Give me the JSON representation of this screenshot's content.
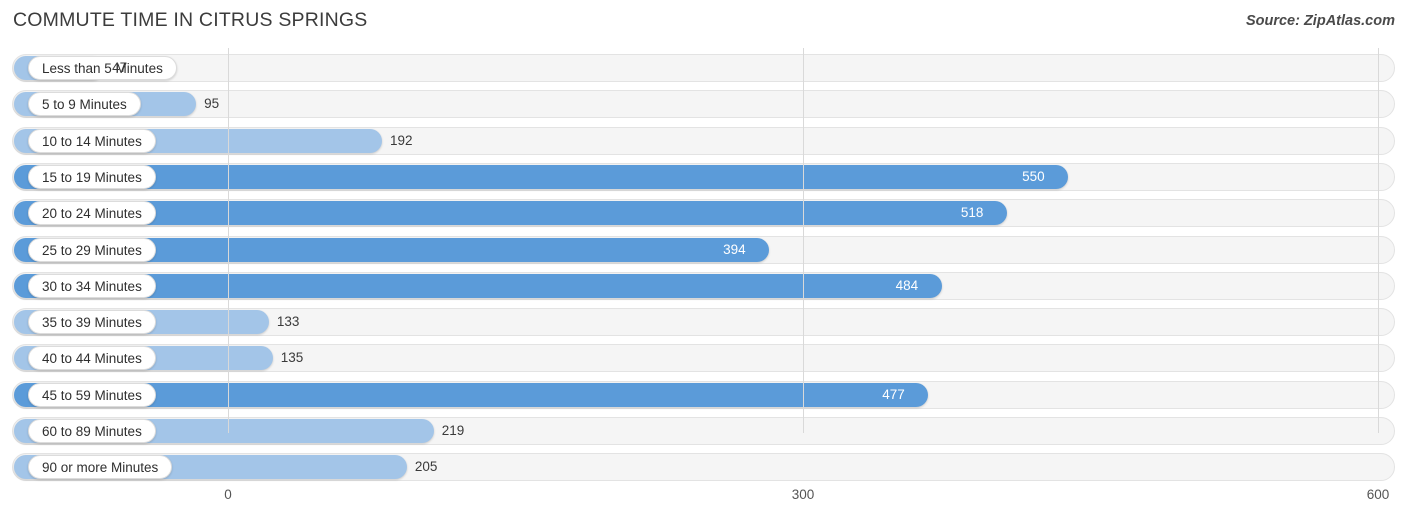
{
  "header": {
    "title": "COMMUTE TIME IN CITRUS SPRINGS",
    "source": "Source: ZipAtlas.com"
  },
  "colors": {
    "bar_light": "#a3c5e8",
    "bar_dark": "#5b9bd9",
    "track": "#f5f5f5",
    "gridline": "#d9d9d9"
  },
  "chart_data": {
    "type": "bar",
    "orientation": "horizontal",
    "title": "COMMUTE TIME IN CITRUS SPRINGS",
    "xlabel": "",
    "ylabel": "",
    "xlim": [
      0,
      600
    ],
    "ticks": [
      "0",
      "300",
      "600"
    ],
    "tick_values": [
      0,
      300,
      600
    ],
    "grid": true,
    "legend": false,
    "categories": [
      "Less than 5 Minutes",
      "5 to 9 Minutes",
      "10 to 14 Minutes",
      "15 to 19 Minutes",
      "20 to 24 Minutes",
      "25 to 29 Minutes",
      "30 to 34 Minutes",
      "35 to 39 Minutes",
      "40 to 44 Minutes",
      "45 to 59 Minutes",
      "60 to 89 Minutes",
      "90 or more Minutes"
    ],
    "values": [
      47,
      95,
      192,
      550,
      518,
      394,
      484,
      133,
      135,
      477,
      219,
      205
    ],
    "labels": [
      "47",
      "95",
      "192",
      "550",
      "518",
      "394",
      "484",
      "133",
      "135",
      "477",
      "219",
      "205"
    ]
  }
}
